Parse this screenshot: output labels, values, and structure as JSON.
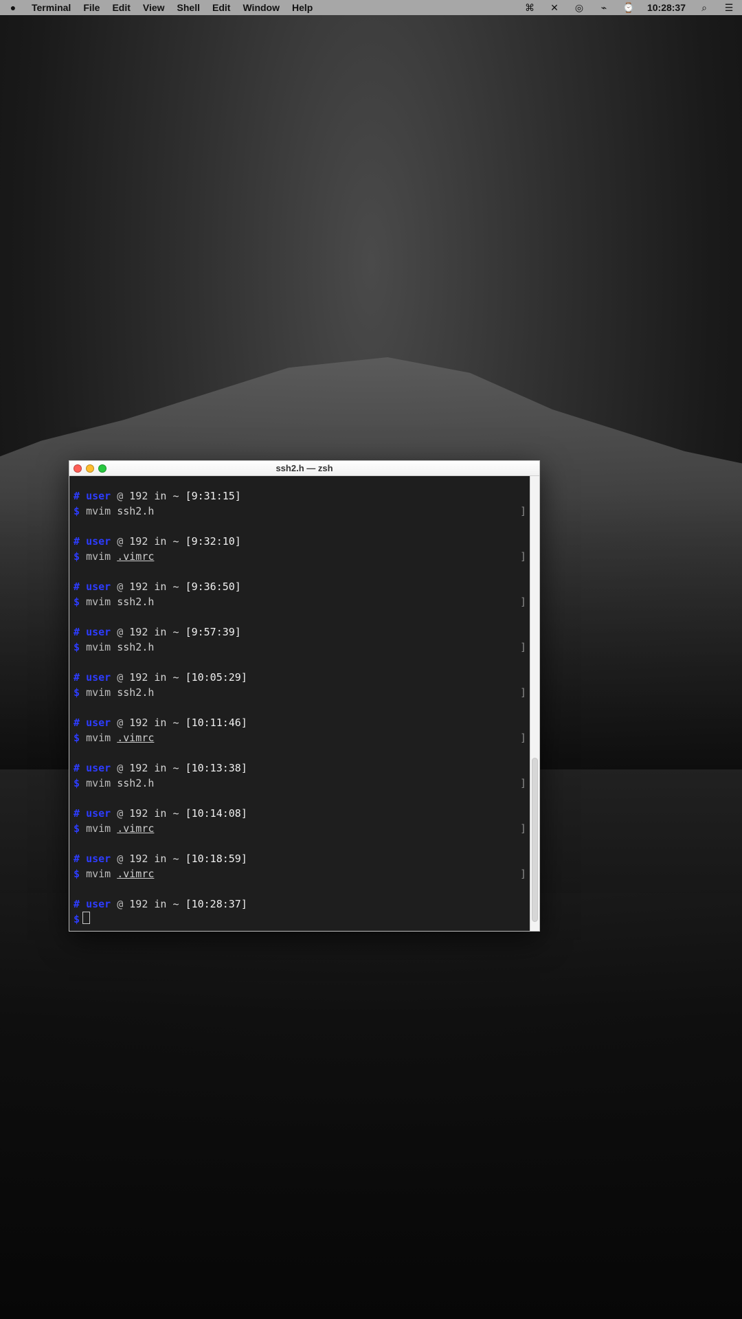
{
  "menubar": {
    "left": [
      {
        "name": "apple-menu-icon",
        "label": ""
      },
      {
        "name": "app-menu-terminal",
        "label": "Terminal"
      },
      {
        "name": "menu-file",
        "label": "File"
      },
      {
        "name": "menu-edit",
        "label": "Edit"
      },
      {
        "name": "menu-view",
        "label": "View"
      },
      {
        "name": "menu-shell",
        "label": "Shell"
      },
      {
        "name": "menu-edit-2",
        "label": "Edit"
      },
      {
        "name": "menu-window",
        "label": "Window"
      },
      {
        "name": "menu-help",
        "label": "Help"
      }
    ],
    "right": [
      {
        "name": "status-icon-1",
        "label": "⌘"
      },
      {
        "name": "status-icon-2",
        "label": "✕"
      },
      {
        "name": "status-icon-3",
        "label": "◎"
      },
      {
        "name": "status-icon-4",
        "label": "⌁"
      },
      {
        "name": "status-icon-5",
        "label": "⌚"
      },
      {
        "name": "status-clock",
        "label": "10:28:37"
      },
      {
        "name": "status-search",
        "label": "⌕"
      },
      {
        "name": "status-menu",
        "label": "☰"
      }
    ]
  },
  "terminal": {
    "title": "ssh2.h — zsh",
    "blocks": [
      {
        "prompt_hash": "#",
        "user": "user",
        "at": "@",
        "host": "192",
        "in": "in",
        "path": "~",
        "time": "[9:31:15]",
        "cmd_prefix": "$",
        "cmd": "mvim",
        "file": "ssh2.h",
        "file_underline": false,
        "right_mark": "]"
      },
      {
        "prompt_hash": "#",
        "user": "user",
        "at": "@",
        "host": "192",
        "in": "in",
        "path": "~",
        "time": "[9:32:10]",
        "cmd_prefix": "$",
        "cmd": "mvim",
        "file": ".vimrc",
        "file_underline": true,
        "right_mark": "]"
      },
      {
        "prompt_hash": "#",
        "user": "user",
        "at": "@",
        "host": "192",
        "in": "in",
        "path": "~",
        "time": "[9:36:50]",
        "cmd_prefix": "$",
        "cmd": "mvim",
        "file": "ssh2.h",
        "file_underline": false,
        "right_mark": "]"
      },
      {
        "prompt_hash": "#",
        "user": "user",
        "at": "@",
        "host": "192",
        "in": "in",
        "path": "~",
        "time": "[9:57:39]",
        "cmd_prefix": "$",
        "cmd": "mvim",
        "file": "ssh2.h",
        "file_underline": false,
        "right_mark": "]"
      },
      {
        "prompt_hash": "#",
        "user": "user",
        "at": "@",
        "host": "192",
        "in": "in",
        "path": "~",
        "time": "[10:05:29]",
        "cmd_prefix": "$",
        "cmd": "mvim",
        "file": "ssh2.h",
        "file_underline": false,
        "right_mark": "]"
      },
      {
        "prompt_hash": "#",
        "user": "user",
        "at": "@",
        "host": "192",
        "in": "in",
        "path": "~",
        "time": "[10:11:46]",
        "cmd_prefix": "$",
        "cmd": "mvim",
        "file": ".vimrc",
        "file_underline": true,
        "right_mark": "]"
      },
      {
        "prompt_hash": "#",
        "user": "user",
        "at": "@",
        "host": "192",
        "in": "in",
        "path": "~",
        "time": "[10:13:38]",
        "cmd_prefix": "$",
        "cmd": "mvim",
        "file": "ssh2.h",
        "file_underline": false,
        "right_mark": "]"
      },
      {
        "prompt_hash": "#",
        "user": "user",
        "at": "@",
        "host": "192",
        "in": "in",
        "path": "~",
        "time": "[10:14:08]",
        "cmd_prefix": "$",
        "cmd": "mvim",
        "file": ".vimrc",
        "file_underline": true,
        "right_mark": "]"
      },
      {
        "prompt_hash": "#",
        "user": "user",
        "at": "@",
        "host": "192",
        "in": "in",
        "path": "~",
        "time": "[10:18:59]",
        "cmd_prefix": "$",
        "cmd": "mvim",
        "file": ".vimrc",
        "file_underline": true,
        "right_mark": "]"
      },
      {
        "prompt_hash": "#",
        "user": "user",
        "at": "@",
        "host": "192",
        "in": "in",
        "path": "~",
        "time": "[10:28:37]",
        "cmd_prefix": "$",
        "cmd": "",
        "file": "",
        "file_underline": false,
        "right_mark": ""
      }
    ]
  }
}
